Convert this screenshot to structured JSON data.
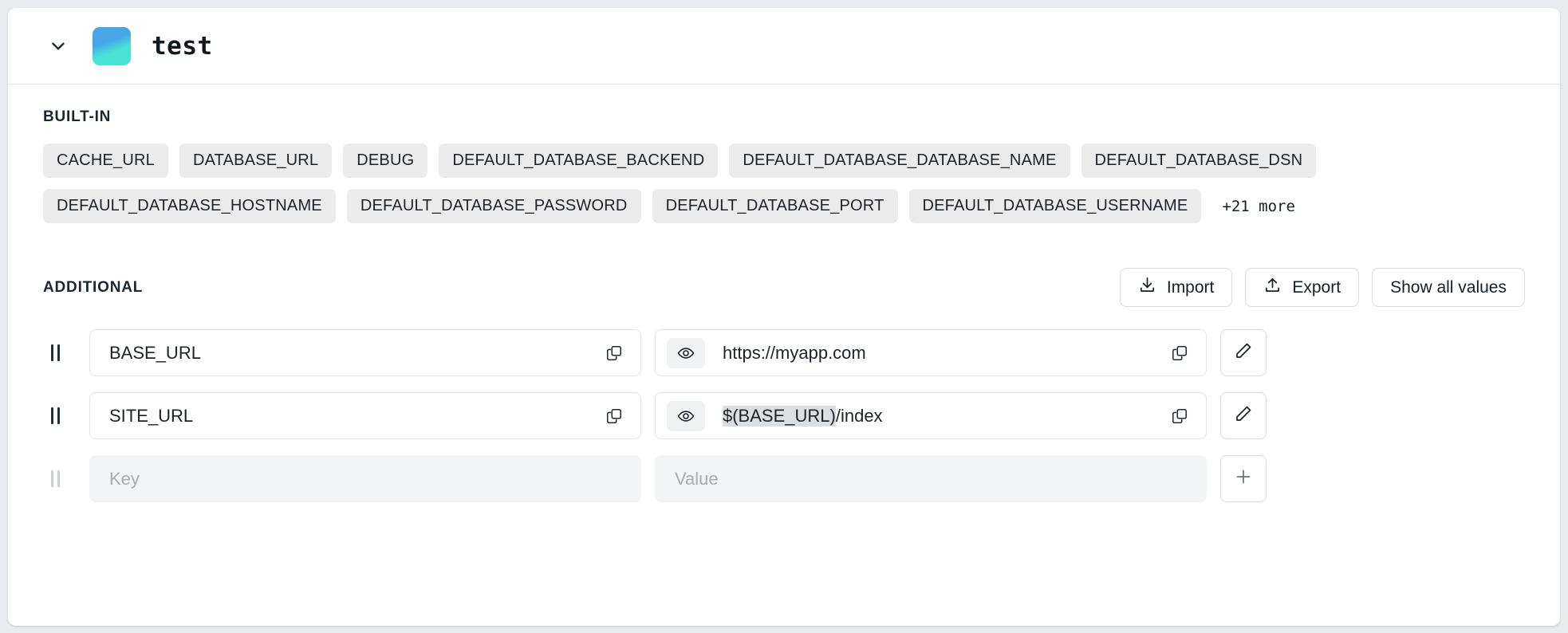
{
  "header": {
    "collapse_icon": "chevron-down-icon",
    "logo_icon": "project-logo",
    "title": "test"
  },
  "builtin": {
    "label": "BUILT-IN",
    "chips": [
      "CACHE_URL",
      "DATABASE_URL",
      "DEBUG",
      "DEFAULT_DATABASE_BACKEND",
      "DEFAULT_DATABASE_DATABASE_NAME",
      "DEFAULT_DATABASE_DSN",
      "DEFAULT_DATABASE_HOSTNAME",
      "DEFAULT_DATABASE_PASSWORD",
      "DEFAULT_DATABASE_PORT",
      "DEFAULT_DATABASE_USERNAME"
    ],
    "more_label": "+21 more"
  },
  "additional": {
    "label": "ADDITIONAL",
    "toolbar": {
      "import_label": "Import",
      "import_icon": "download-icon",
      "export_label": "Export",
      "export_icon": "upload-icon",
      "show_all_label": "Show all values"
    },
    "rows": [
      {
        "key": "BASE_URL",
        "value_prefix": "https://myapp.com",
        "value_ref": "",
        "value_suffix": "",
        "visibility_icon": "eye-icon",
        "copy_key_icon": "copy-icon",
        "copy_value_icon": "copy-icon",
        "action_icon": "pencil-icon"
      },
      {
        "key": "SITE_URL",
        "value_prefix": "",
        "value_ref": "$(BASE_URL)",
        "value_suffix": "/index",
        "visibility_icon": "eye-icon",
        "copy_key_icon": "copy-icon",
        "copy_value_icon": "copy-icon",
        "action_icon": "pencil-icon"
      }
    ],
    "new_row": {
      "key_placeholder": "Key",
      "value_placeholder": "Value",
      "action_icon": "plus-icon"
    }
  },
  "colors": {
    "page_bg": "#e9ebee",
    "card_bg": "#ffffff",
    "chip_bg": "#ebebeb",
    "highlight_bg": "#dcdfe1",
    "logo_from": "#46a6e8",
    "logo_to": "#48e3d4",
    "text": "#1d2329"
  }
}
